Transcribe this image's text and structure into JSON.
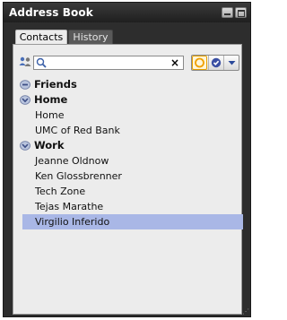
{
  "window": {
    "title": "Address Book"
  },
  "tabs": [
    {
      "label": "Contacts",
      "active": true
    },
    {
      "label": "History",
      "active": false
    }
  ],
  "search": {
    "value": "",
    "placeholder": "",
    "clear_symbol": "×"
  },
  "toolbar_buttons": [
    {
      "icon": "status-ring-icon"
    },
    {
      "icon": "check-circle-icon"
    },
    {
      "icon": "chevron-down-icon"
    }
  ],
  "contacts_tree": [
    {
      "type": "group",
      "label": "Friends",
      "expanded": false,
      "items": []
    },
    {
      "type": "group",
      "label": "Home",
      "expanded": true,
      "items": [
        "Home",
        "UMC of Red Bank"
      ]
    },
    {
      "type": "group",
      "label": "Work",
      "expanded": true,
      "items": [
        "Jeanne Oldnow",
        "Ken Glossbrenner",
        "Tech Zone",
        "Tejas Marathe",
        "Virgilio Inferido"
      ]
    }
  ],
  "selected_item": "Virgilio Inferido",
  "colors": {
    "window_bg": "#2d2d2d",
    "panel_bg": "#ececec",
    "selection": "#a9b7e6",
    "accent_orange": "#e7a000",
    "check_blue": "#3a4fa3"
  }
}
